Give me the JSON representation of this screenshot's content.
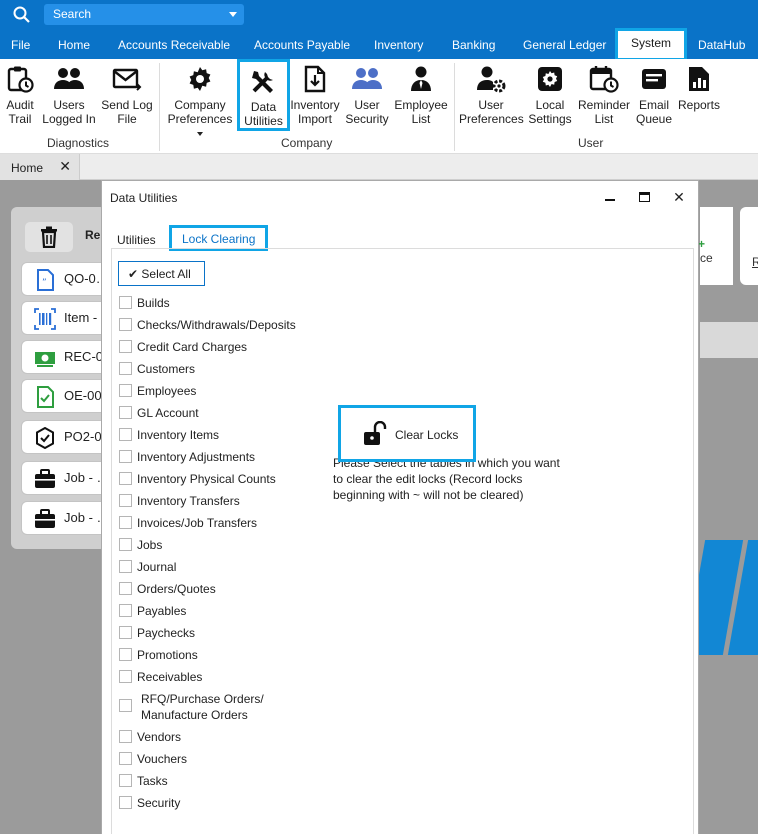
{
  "search": {
    "placeholder": "Search"
  },
  "menu": [
    "File",
    "Home",
    "Accounts Receivable",
    "Accounts Payable",
    "Inventory",
    "Banking",
    "General Ledger",
    "System",
    "DataHub"
  ],
  "ribbon": {
    "diagnostics": {
      "label": "Diagnostics",
      "items": [
        [
          "Audit",
          "Trail"
        ],
        [
          "Users",
          "Logged In"
        ],
        [
          "Send Log",
          "File"
        ]
      ]
    },
    "company": {
      "label": "Company",
      "items": [
        [
          "Company",
          "Preferences"
        ],
        [
          "Data",
          "Utilities"
        ],
        [
          "Inventory",
          "Import"
        ],
        [
          "User",
          "Security"
        ],
        [
          "Employee",
          "List"
        ]
      ]
    },
    "user": {
      "label": "User",
      "items": [
        [
          "User",
          "Preferences"
        ],
        [
          "Local",
          "Settings"
        ],
        [
          "Reminder",
          "List"
        ],
        [
          "Email",
          "Queue"
        ],
        [
          "Reports",
          ""
        ]
      ]
    }
  },
  "doc_tab": {
    "label": "Home",
    "close": "✕"
  },
  "background": {
    "header": "Re",
    "items": [
      "QO-0…",
      "Item - …",
      "REC-0…",
      "OE-00…",
      "PO2-0…",
      "Job - …",
      "Job - …"
    ],
    "right_text_1": "ce",
    "right_text_2": "R"
  },
  "dialog": {
    "title": "Data Utilities",
    "minimize": "—",
    "maximize": "☐",
    "close": "✕",
    "tabs": [
      "Utilities",
      "Lock Clearing"
    ],
    "select_all": "Select All",
    "tables": [
      "Builds",
      "Checks/Withdrawals/Deposits",
      "Credit Card Charges",
      "Customers",
      "Employees",
      "GL Account",
      "Inventory Items",
      "Inventory Adjustments",
      "Inventory Physical Counts",
      "Inventory Transfers",
      "Invoices/Job Transfers",
      "Jobs",
      "Journal",
      "Orders/Quotes",
      "Payables",
      "Paychecks",
      "Promotions",
      "Receivables",
      "RFQ/Purchase Orders/",
      "Manufacture Orders",
      "Vendors",
      "Vouchers",
      "Tasks",
      "Security"
    ],
    "note": [
      "Please Select the tables in which you want",
      "to clear the edit locks (Record locks",
      "beginning with ~ will not be cleared)"
    ],
    "clear_locks": "Clear Locks"
  },
  "colors": {
    "brand": "#0a73c8",
    "highlight": "#10a5e6"
  }
}
